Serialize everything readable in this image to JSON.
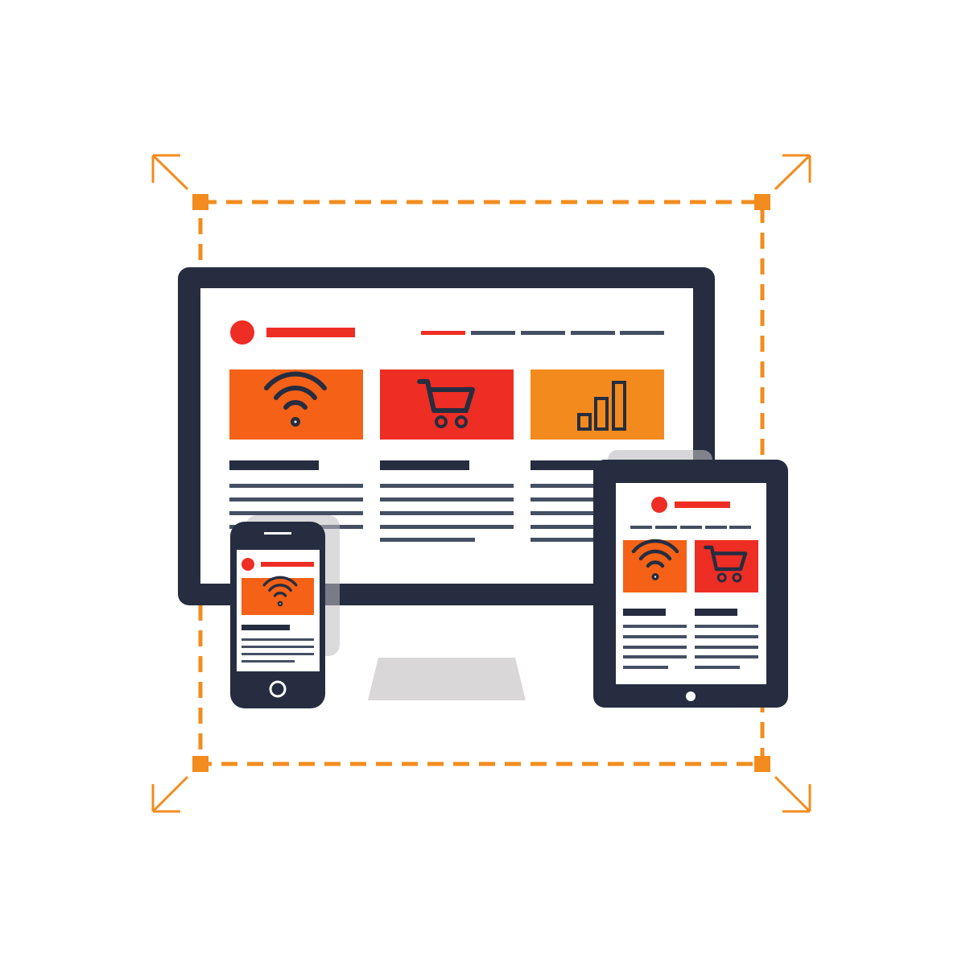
{
  "illustration": {
    "subject": "responsive-design",
    "icons": [
      "wifi-icon",
      "shopping-cart-icon",
      "bar-chart-icon",
      "resize-arrow-icon"
    ]
  },
  "colors": {
    "frame": "#262d40",
    "screen": "#ffffff",
    "accent_red": "#ee2d24",
    "accent_orange": "#f46117",
    "accent_amber": "#f28a1e",
    "dashed_border": "#f28c1e",
    "text_lines": "#454f63",
    "shadow": "#d9d7d8"
  }
}
